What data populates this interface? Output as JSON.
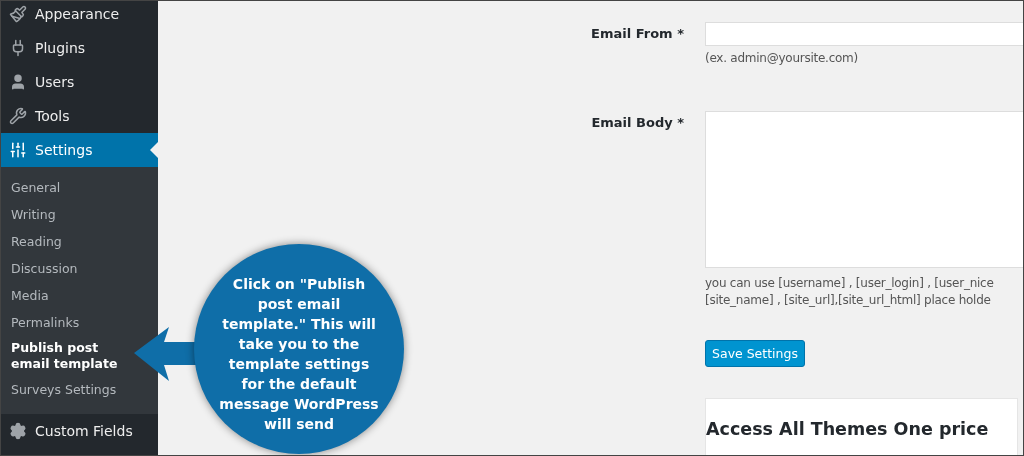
{
  "sidebar": {
    "items": [
      {
        "label": "Appearance",
        "kind": "brush",
        "selected": false
      },
      {
        "label": "Plugins",
        "kind": "plug",
        "selected": false
      },
      {
        "label": "Users",
        "kind": "user",
        "selected": false
      },
      {
        "label": "Tools",
        "kind": "wrench",
        "selected": false
      },
      {
        "label": "Settings",
        "kind": "sliders",
        "selected": true,
        "children": [
          {
            "label": "General",
            "selected": false
          },
          {
            "label": "Writing",
            "selected": false
          },
          {
            "label": "Reading",
            "selected": false
          },
          {
            "label": "Discussion",
            "selected": false
          },
          {
            "label": "Media",
            "selected": false
          },
          {
            "label": "Permalinks",
            "selected": false
          },
          {
            "label": "Publish post email template",
            "selected": true
          },
          {
            "label": "Surveys Settings",
            "selected": false
          }
        ]
      },
      {
        "label": "Custom Fields",
        "kind": "gear",
        "selected": false
      }
    ]
  },
  "form": {
    "fields": [
      {
        "label": "Email From *",
        "kind": "input",
        "hint": [
          "(ex. admin@yoursite.com)"
        ]
      },
      {
        "label": "Email Body *",
        "kind": "textarea",
        "hint": [
          "you can use [username] , [user_login] , [user_nice",
          "[site_name] , [site_url],[site_url_html] place holde"
        ]
      }
    ],
    "button": "Save Settings"
  },
  "card": {
    "title": "Access All Themes One price"
  },
  "callout": {
    "text": "Click on \"Publish post email template.\" This will take you to the template settings for the default message WordPress will send"
  }
}
